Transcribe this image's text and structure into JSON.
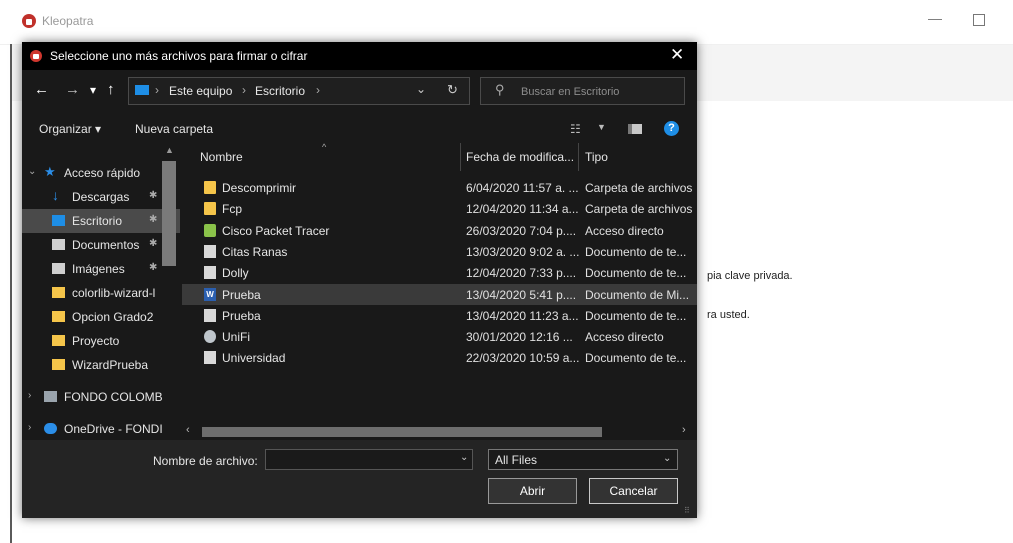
{
  "background_window": {
    "title": "Kleopatra",
    "text_1": "pia clave privada.",
    "text_2": "ra usted."
  },
  "dialog": {
    "title": "Seleccione uno más archivos para firmar o cifrar",
    "close_glyph": "✕"
  },
  "navigation": {
    "back": "←",
    "forward": "→",
    "recent": "▾",
    "up": "↑",
    "breadcrumb": [
      "Este equipo",
      "Escritorio"
    ],
    "crumb_separator": "›",
    "dropdown": "⌄",
    "refresh": "↻",
    "search_placeholder": "Buscar en Escritorio"
  },
  "commands": {
    "organize": "Organizar ▾",
    "new_folder": "Nueva carpeta",
    "view_glyph": "☷",
    "view_drop": "▼",
    "help": "?"
  },
  "nav_pane": {
    "items": [
      {
        "label": "Acceso rápido",
        "icon": "star-icon",
        "color": "#2b8ee8"
      },
      {
        "label": "Descargas",
        "icon": "download-icon",
        "color": "#2b8ee8"
      },
      {
        "label": "Escritorio",
        "icon": "desktop-icon",
        "color": "#1e8ee6"
      },
      {
        "label": "Documentos",
        "icon": "document-icon",
        "color": "#cfcfcf"
      },
      {
        "label": "Imágenes",
        "icon": "images-icon",
        "color": "#cfcfcf"
      },
      {
        "label": "colorlib-wizard-l",
        "icon": "folder-icon",
        "color": "#f5c54a"
      },
      {
        "label": "Opcion Grado2",
        "icon": "folder-icon",
        "color": "#f5c54a"
      },
      {
        "label": "Proyecto",
        "icon": "folder-icon",
        "color": "#f5c54a"
      },
      {
        "label": "WizardPrueba",
        "icon": "folder-icon",
        "color": "#f5c54a"
      },
      {
        "label": "FONDO COLOMB",
        "icon": "building-icon",
        "color": "#9aa4ad"
      },
      {
        "label": "OneDrive - FONDI",
        "icon": "cloud-icon",
        "color": "#2b8ee8"
      }
    ],
    "pin_glyph": "✱"
  },
  "file_list": {
    "columns": [
      "Nombre",
      "Fecha de modifica...",
      "Tipo"
    ],
    "rows": [
      {
        "name": "Descomprimir",
        "date": "6/04/2020 11:57 a. ...",
        "type": "Carpeta de archivos",
        "icon": "folder"
      },
      {
        "name": "Fcp",
        "date": "12/04/2020 11:34 a...",
        "type": "Carpeta de archivos",
        "icon": "folder"
      },
      {
        "name": "Cisco Packet Tracer",
        "date": "26/03/2020 7:04 p....",
        "type": "Acceso directo",
        "icon": "shortcut"
      },
      {
        "name": "Citas Ranas",
        "date": "13/03/2020 9:02 a. ...",
        "type": "Documento de te...",
        "icon": "doc"
      },
      {
        "name": "Dolly",
        "date": "12/04/2020 7:33 p....",
        "type": "Documento de te...",
        "icon": "doc"
      },
      {
        "name": "Prueba",
        "date": "13/04/2020 5:41 p....",
        "type": "Documento de Mi...",
        "icon": "word"
      },
      {
        "name": "Prueba",
        "date": "13/04/2020 11:23 a...",
        "type": "Documento de te...",
        "icon": "doc"
      },
      {
        "name": "UniFi",
        "date": "30/01/2020 12:16 ...",
        "type": "Acceso directo",
        "icon": "unifi"
      },
      {
        "name": "Universidad",
        "date": "22/03/2020 10:59 a...",
        "type": "Documento de te...",
        "icon": "doc"
      }
    ],
    "hovered_index": 5
  },
  "bottom": {
    "filename_label": "Nombre de archivo:",
    "filename_value": "",
    "filter_value": "All Files",
    "open_button": "Abrir",
    "cancel_button": "Cancelar"
  },
  "colors": {
    "dialog_bg": "#191919",
    "accent": "#1e8ee6",
    "folder": "#f5c54a"
  }
}
